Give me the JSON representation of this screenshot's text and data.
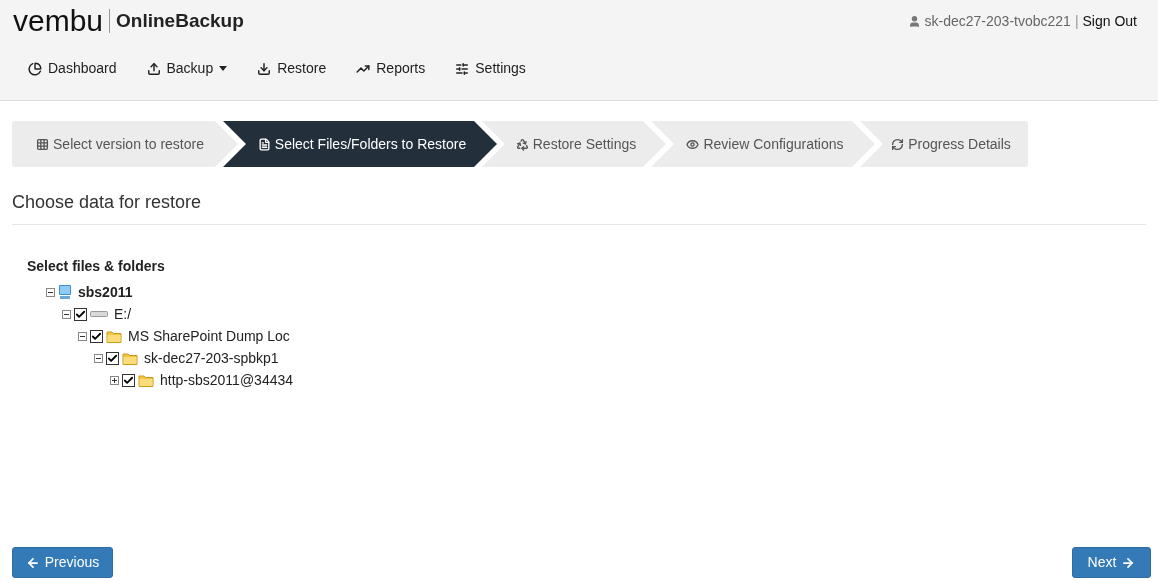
{
  "logo": {
    "brand": "vembu",
    "product": "OnlineBackup"
  },
  "user": {
    "name": "sk-dec27-203-tvobc221",
    "separator": "|",
    "sign_out": "Sign Out"
  },
  "nav": [
    {
      "label": "Dashboard",
      "dropdown": false
    },
    {
      "label": "Backup",
      "dropdown": true
    },
    {
      "label": "Restore",
      "dropdown": false
    },
    {
      "label": "Reports",
      "dropdown": false
    },
    {
      "label": "Settings",
      "dropdown": false
    }
  ],
  "steps": [
    {
      "label": "Select version to restore",
      "selected": false
    },
    {
      "label": "Select Files/Folders to Restore",
      "selected": true
    },
    {
      "label": "Restore Settings",
      "selected": false
    },
    {
      "label": "Review Configurations",
      "selected": false
    },
    {
      "label": "Progress Details",
      "selected": false
    }
  ],
  "section_title": "Choose data for restore",
  "tree_title": "Select files & folders",
  "tree": [
    {
      "label": "sbs2011",
      "kind": "computer",
      "expanded": true,
      "children": [
        {
          "label": "E:/",
          "kind": "drive",
          "expanded": true,
          "checked": true,
          "children": [
            {
              "label": "MS SharePoint Dump Loc",
              "kind": "folder",
              "expanded": true,
              "checked": true,
              "children": [
                {
                  "label": "sk-dec27-203-spbkp1",
                  "kind": "folder",
                  "expanded": true,
                  "checked": true,
                  "children": [
                    {
                      "label": "http-sbs2011@34434",
                      "kind": "folder",
                      "expanded": false,
                      "checked": true
                    }
                  ]
                }
              ]
            }
          ]
        }
      ]
    }
  ],
  "buttons": {
    "previous": "Previous",
    "next": "Next"
  }
}
